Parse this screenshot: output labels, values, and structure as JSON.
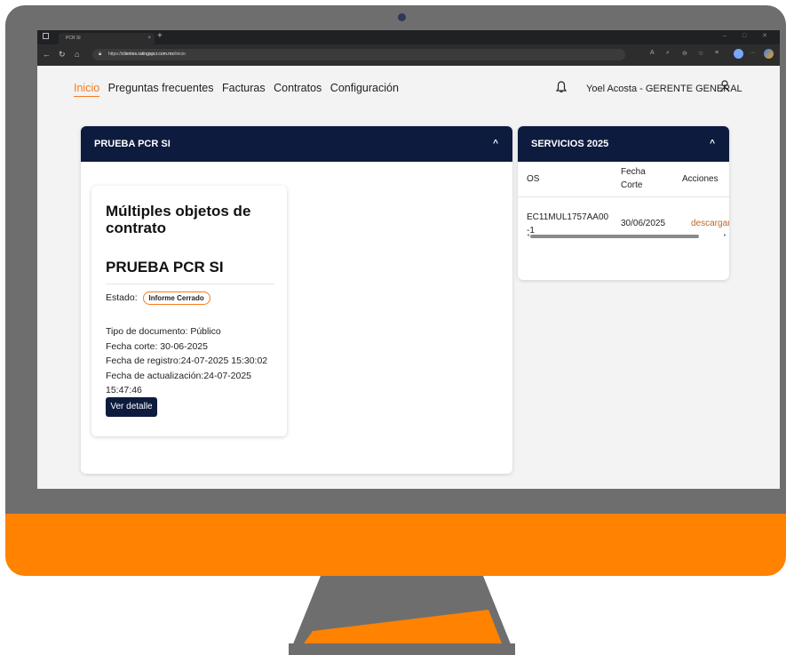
{
  "browser": {
    "tab_title": "PCR SI",
    "tab_close": "×",
    "new_tab": "+",
    "url_prefix": "https://",
    "url_host": "clientes.ratingspcr.com.mx",
    "url_path": "/inicio"
  },
  "nav": {
    "items": [
      "Inicio",
      "Preguntas frecuentes",
      "Facturas",
      "Contratos",
      "Configuración"
    ],
    "active_index": 0,
    "user_label": "Yoel Acosta - GERENTE GENERAL"
  },
  "main_card": {
    "header": "PRUEBA PCR SI",
    "contract_title": "Múltiples objetos de contrato",
    "contract_name": "PRUEBA PCR SI",
    "estado_label": "Estado:",
    "estado_value": "Informe Cerrado",
    "tipo_documento": "Tipo de documento: Público",
    "fecha_corte": "Fecha corte: 30-06-2025",
    "fecha_registro": "Fecha de registro:24-07-2025 15:30:02",
    "fecha_actualizacion": "Fecha de actualización:24-07-2025 15:47:46",
    "button_label": "Ver detalle"
  },
  "services_card": {
    "header": "SERVICIOS 2025",
    "columns": [
      "OS",
      "Fecha Corte",
      "Acciones"
    ],
    "rows": [
      {
        "os": "EC11MUL1757AA00-1",
        "fecha_corte": "30/06/2025",
        "accion": "descargar("
      }
    ]
  },
  "colors": {
    "accent": "#f47c20",
    "navy": "#0d1b3e",
    "monitor_orange": "#ff8200",
    "monitor_gray": "#6e6e6e"
  },
  "icons": [
    "bell-icon",
    "user-icon",
    "chevron-up-icon",
    "back-icon",
    "refresh-icon",
    "home-icon",
    "lock-icon"
  ]
}
